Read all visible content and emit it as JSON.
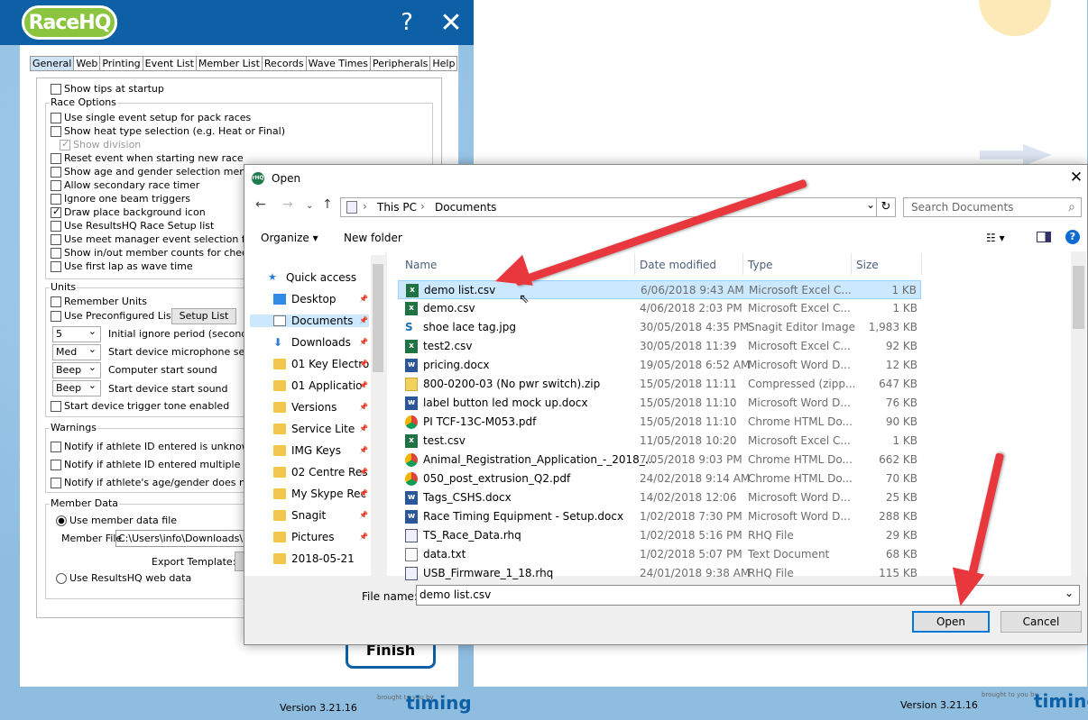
{
  "app": {
    "logo": "RaceHQ",
    "help": "?",
    "close": "✕",
    "tabs": [
      "General",
      "Web",
      "Printing",
      "Event List",
      "Member List",
      "Records",
      "Wave Times",
      "Peripherals",
      "Help"
    ],
    "top_options": [
      "Show tips at startup"
    ],
    "race_options_label": "Race Options",
    "race_options": [
      {
        "label": "Use single event setup for pack races",
        "checked": false
      },
      {
        "label": "Show heat type selection (e.g. Heat or Final)",
        "checked": false
      },
      {
        "label": "Show division",
        "checked": true,
        "disabled": true
      },
      {
        "label": "Reset event when starting new race",
        "checked": false
      },
      {
        "label": "Show age and gender selection menus",
        "checked": false
      },
      {
        "label": "Allow secondary race timer",
        "checked": false
      },
      {
        "label": "Ignore one beam triggers",
        "checked": false
      },
      {
        "label": "Draw place background icon",
        "checked": true
      },
      {
        "label": "Use ResultsHQ Race Setup list",
        "checked": false
      },
      {
        "label": "Use meet manager event selection files",
        "checked": false
      },
      {
        "label": "Show in/out member counts for checkpoin",
        "checked": false
      },
      {
        "label": "Use first lap as wave time",
        "checked": false
      }
    ],
    "units_label": "Units",
    "remember_units": "Remember Units",
    "preconfigured": "Use Preconfigured List:",
    "setup_list": "Setup List",
    "selects": [
      {
        "value": "5",
        "label": "Initial ignore period (seconds)"
      },
      {
        "value": "Med",
        "label": "Start device microphone sensiti"
      },
      {
        "value": "Beep",
        "label": "Computer start sound"
      },
      {
        "value": "Beep",
        "label": "Start device start sound"
      }
    ],
    "start_tone": "Start device trigger tone enabled",
    "warnings_label": "Warnings",
    "warnings": [
      "Notify if athlete ID entered is unknown",
      "Notify if athlete ID entered multiple times",
      "Notify if athlete's age/gender does not ma"
    ],
    "member_data_label": "Member Data",
    "use_member_file": "Use member data file",
    "member_file_label": "Member File",
    "member_file_value": "C:\\Users\\info\\Downloads\\KF",
    "export_template": "Export Template:",
    "use_web": "Use ResultsHQ web data",
    "finish": "Finish",
    "version": "Version 3.21.16",
    "brought": "brought to you by",
    "brand": "timing"
  },
  "right": {
    "version": "Version 3.21.16",
    "brought": "brought to you by",
    "brand": "timing"
  },
  "dialog": {
    "title": "Open",
    "icon": "rHQ",
    "close": "✕",
    "path": [
      "This PC",
      "Documents"
    ],
    "search_placeholder": "Search Documents",
    "organize": "Organize ▾",
    "new_folder": "New folder",
    "nav_items": [
      {
        "label": "Quick access",
        "icon": "star"
      },
      {
        "label": "Desktop",
        "icon": "desktop"
      },
      {
        "label": "Documents",
        "icon": "doc"
      },
      {
        "label": "Downloads",
        "icon": "download"
      },
      {
        "label": "01 Key Electro",
        "icon": "folder"
      },
      {
        "label": "01 Applicatio",
        "icon": "folder"
      },
      {
        "label": "Versions",
        "icon": "folder"
      },
      {
        "label": "Service Lite",
        "icon": "folder"
      },
      {
        "label": "IMG Keys",
        "icon": "folder"
      },
      {
        "label": "02 Centre Res",
        "icon": "folder"
      },
      {
        "label": "My Skype Rec",
        "icon": "folder"
      },
      {
        "label": "Snagit",
        "icon": "folder"
      },
      {
        "label": "Pictures",
        "icon": "folder"
      },
      {
        "label": "2018-05-21",
        "icon": "folder"
      }
    ],
    "columns": [
      "Name",
      "Date modified",
      "Type",
      "Size"
    ],
    "files": [
      {
        "name": "demo list.csv",
        "date": "6/06/2018 9:43 AM",
        "type": "Microsoft Excel C...",
        "size": "1 KB",
        "icon": "xl"
      },
      {
        "name": "demo.csv",
        "date": "4/06/2018 2:03 PM",
        "type": "Microsoft Excel C...",
        "size": "1 KB",
        "icon": "xl"
      },
      {
        "name": "shoe lace tag.jpg",
        "date": "30/05/2018 4:35 PM",
        "type": "Snagit Editor Image",
        "size": "1,983 KB",
        "icon": "sg"
      },
      {
        "name": "test2.csv",
        "date": "30/05/2018 11:39",
        "type": "Microsoft Excel C...",
        "size": "92 KB",
        "icon": "xl"
      },
      {
        "name": "pricing.docx",
        "date": "19/05/2018 6:52 AM",
        "type": "Microsoft Word D...",
        "size": "12 KB",
        "icon": "wd"
      },
      {
        "name": "800-0200-03 (No pwr switch).zip",
        "date": "15/05/2018 11:11",
        "type": "Compressed (zipp...",
        "size": "647 KB",
        "icon": "zp"
      },
      {
        "name": "label button led mock up.docx",
        "date": "15/05/2018 11:10",
        "type": "Microsoft Word D...",
        "size": "76 KB",
        "icon": "wd"
      },
      {
        "name": "PI TCF-13C-M053.pdf",
        "date": "15/05/2018 11:10",
        "type": "Chrome HTML Do...",
        "size": "90 KB",
        "icon": "ch"
      },
      {
        "name": "test.csv",
        "date": "11/05/2018 10:20",
        "type": "Microsoft Excel C...",
        "size": "1 KB",
        "icon": "xl"
      },
      {
        "name": "Animal_Registration_Application_-_2018_...",
        "date": "7/05/2018 9:03 PM",
        "type": "Chrome HTML Do...",
        "size": "662 KB",
        "icon": "ch"
      },
      {
        "name": "050_post_extrusion_Q2.pdf",
        "date": "24/02/2018 9:14 AM",
        "type": "Chrome HTML Do...",
        "size": "70 KB",
        "icon": "ch"
      },
      {
        "name": "Tags_CSHS.docx",
        "date": "14/02/2018 12:06",
        "type": "Microsoft Word D...",
        "size": "25 KB",
        "icon": "wd"
      },
      {
        "name": "Race Timing Equipment - Setup.docx",
        "date": "1/02/2018 7:30 PM",
        "type": "Microsoft Word D...",
        "size": "288 KB",
        "icon": "wd"
      },
      {
        "name": "TS_Race_Data.rhq",
        "date": "1/02/2018 5:16 PM",
        "type": "RHQ File",
        "size": "29 KB",
        "icon": "rh"
      },
      {
        "name": "data.txt",
        "date": "1/02/2018 5:07 PM",
        "type": "Text Document",
        "size": "68 KB",
        "icon": "tx"
      },
      {
        "name": "USB_Firmware_1_18.rhq",
        "date": "24/01/2018 9:38 AM",
        "type": "RHQ File",
        "size": "115 KB",
        "icon": "rh"
      }
    ],
    "filename_label": "File name:",
    "filename_value": "demo list.csv",
    "open": "Open",
    "cancel": "Cancel"
  }
}
